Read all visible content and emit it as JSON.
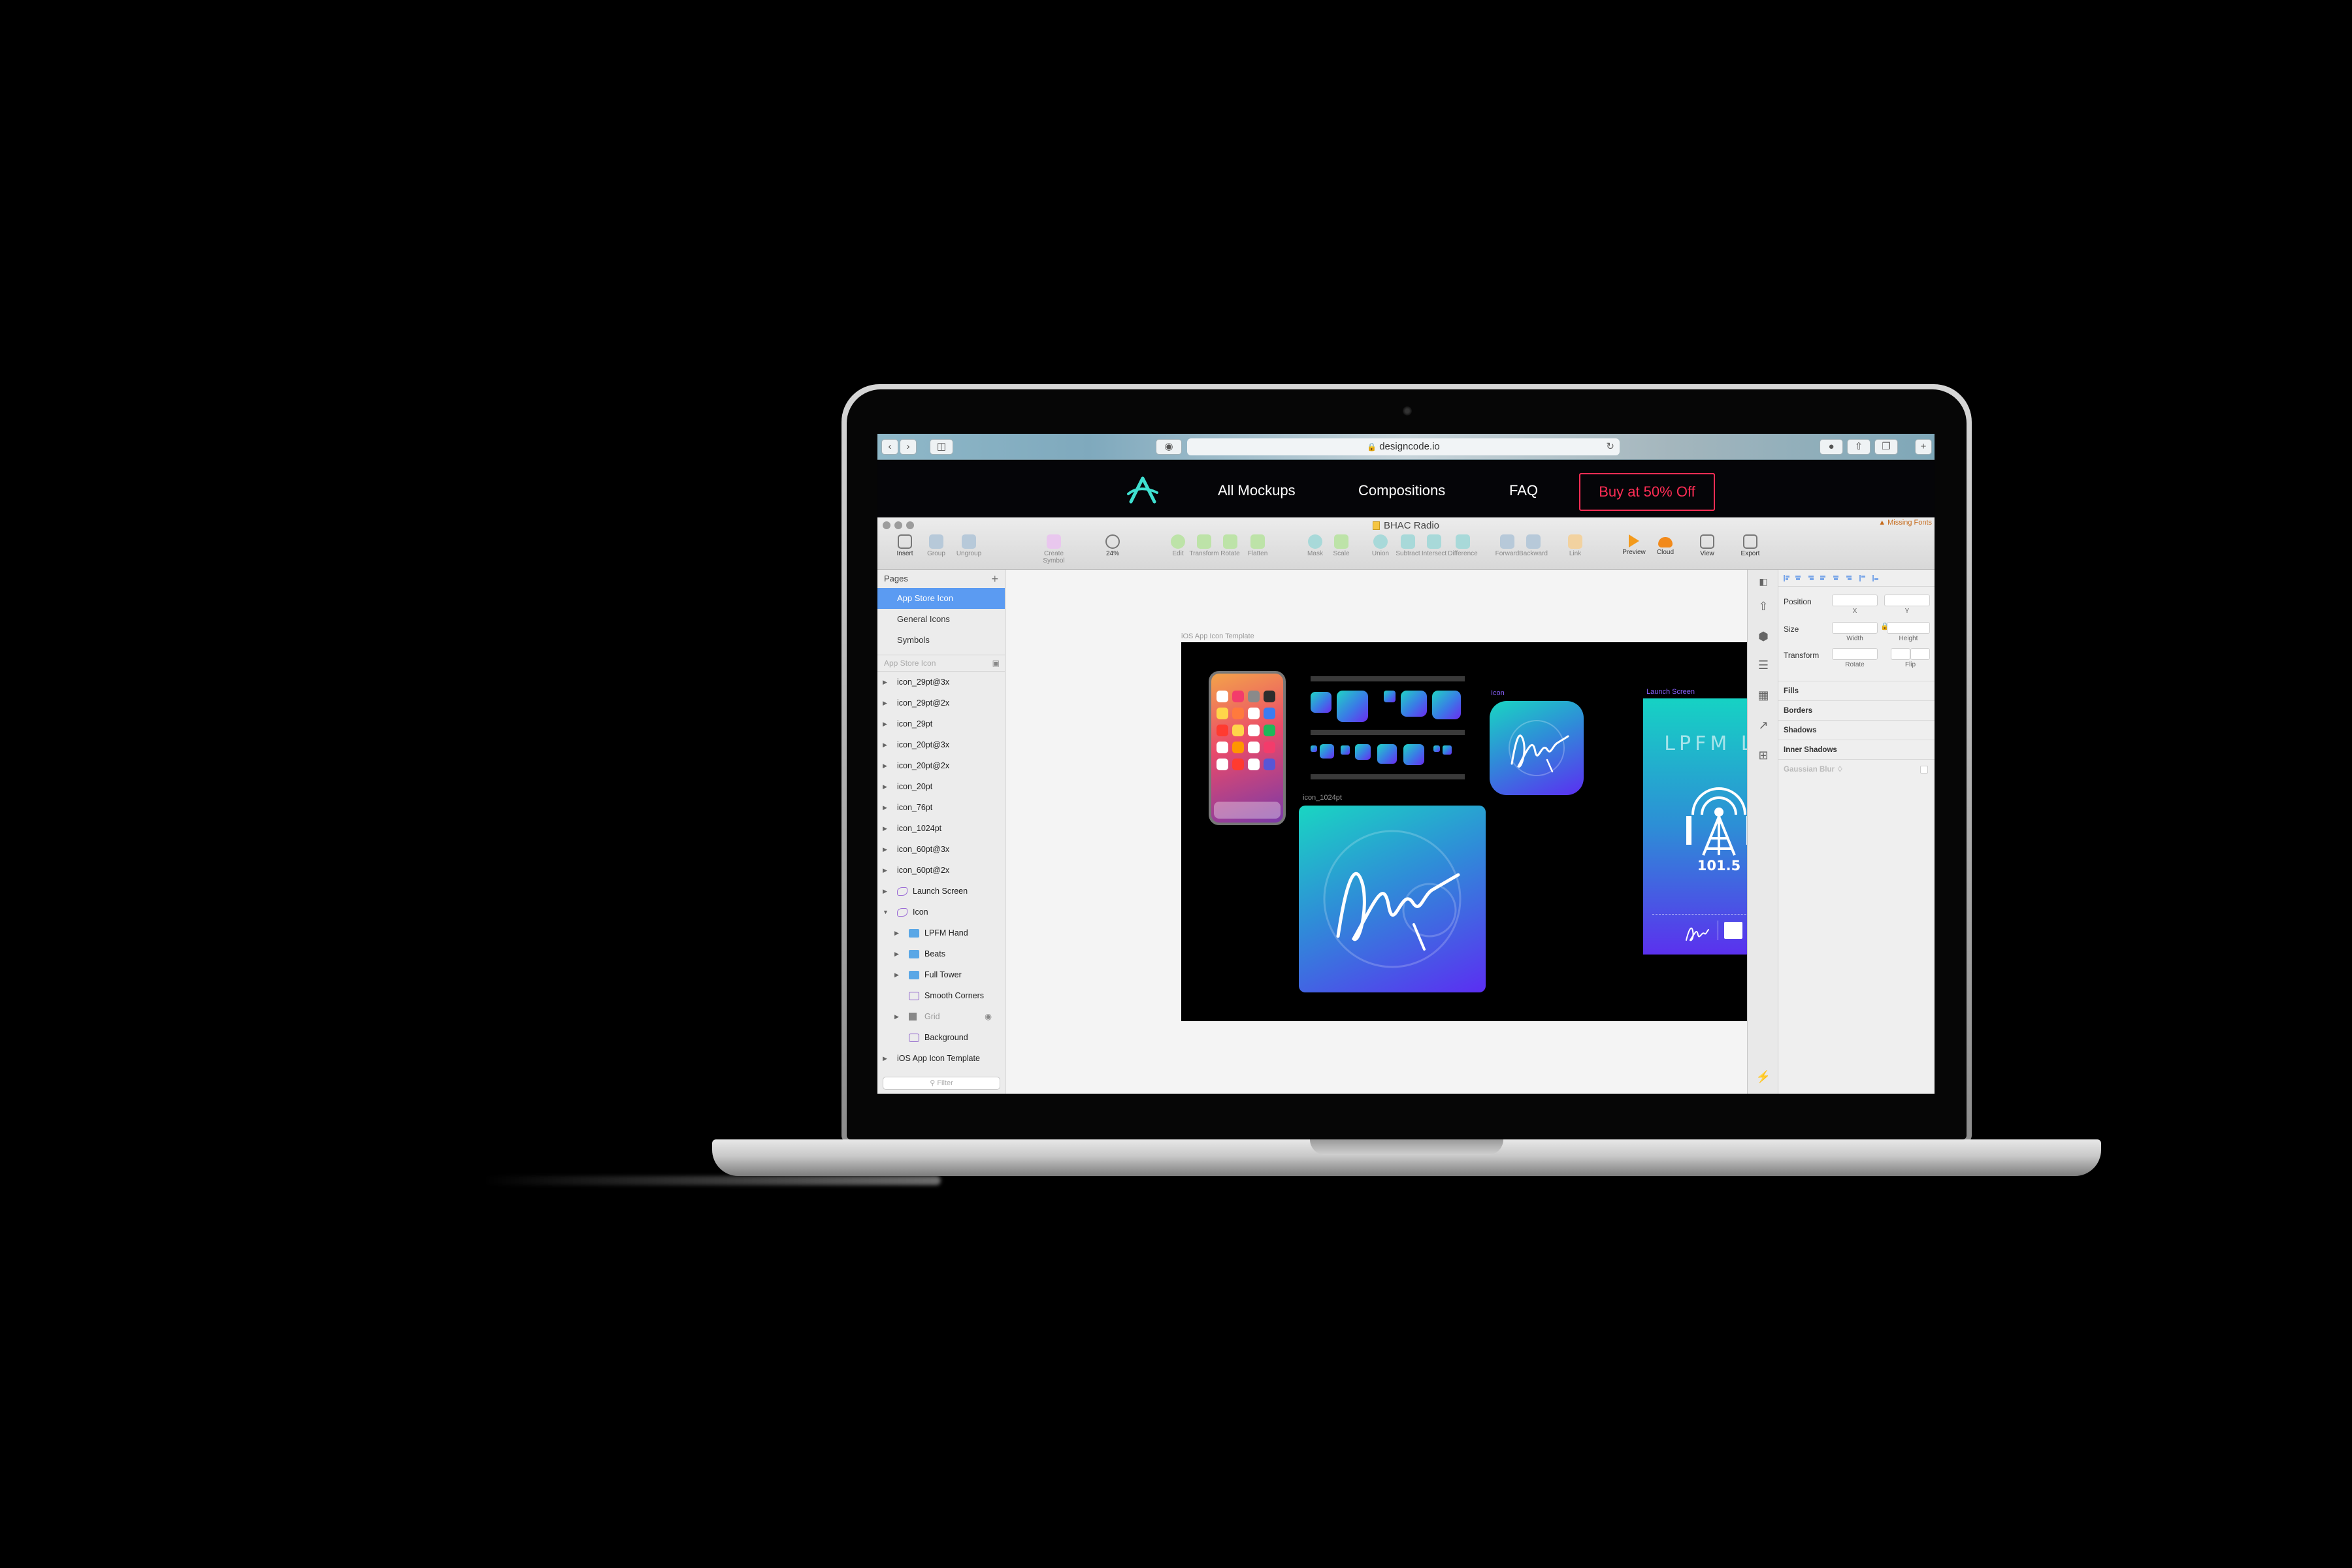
{
  "browser": {
    "url": "designcode.io"
  },
  "site_nav": {
    "links": [
      "All Mockups",
      "Compositions",
      "FAQ"
    ],
    "cta": "Buy at 50% Off",
    "cta_color": "#ff2d55"
  },
  "sketch": {
    "document_title": "BHAC Radio",
    "warning": "▲ Missing Fonts",
    "toolbar": [
      {
        "label": "Insert",
        "icon": "plus-icon",
        "active": true
      },
      {
        "label": "Group",
        "icon": "group-icon",
        "active": false
      },
      {
        "label": "Ungroup",
        "icon": "ungroup-icon",
        "active": false
      },
      {
        "label": "Create Symbol",
        "icon": "symbol-icon",
        "active": false
      },
      {
        "label": "24%",
        "icon": "zoom-icon",
        "active": true
      },
      {
        "label": "Edit",
        "icon": "edit-icon",
        "active": false
      },
      {
        "label": "Transform",
        "icon": "transform-icon",
        "active": false
      },
      {
        "label": "Rotate",
        "icon": "rotate-icon",
        "active": false
      },
      {
        "label": "Flatten",
        "icon": "flatten-icon",
        "active": false
      },
      {
        "label": "Mask",
        "icon": "mask-icon",
        "active": false
      },
      {
        "label": "Scale",
        "icon": "scale-icon",
        "active": false
      },
      {
        "label": "Union",
        "icon": "union-icon",
        "active": false
      },
      {
        "label": "Subtract",
        "icon": "subtract-icon",
        "active": false
      },
      {
        "label": "Intersect",
        "icon": "intersect-icon",
        "active": false
      },
      {
        "label": "Difference",
        "icon": "difference-icon",
        "active": false
      },
      {
        "label": "Forward",
        "icon": "forward-icon",
        "active": false
      },
      {
        "label": "Backward",
        "icon": "backward-icon",
        "active": false
      },
      {
        "label": "Link",
        "icon": "link-icon",
        "active": false
      },
      {
        "label": "Preview",
        "icon": "preview-icon",
        "active": true
      },
      {
        "label": "Cloud",
        "icon": "cloud-icon",
        "active": true
      },
      {
        "label": "View",
        "icon": "view-icon",
        "active": true
      },
      {
        "label": "Export",
        "icon": "export-icon",
        "active": true
      }
    ],
    "pages": {
      "heading": "Pages",
      "items": [
        "App Store Icon",
        "General Icons",
        "Symbols"
      ],
      "selected": "App Store Icon",
      "current_page_label": "App Store Icon"
    },
    "layers": [
      {
        "name": "icon_29pt@3x",
        "type": "artboard"
      },
      {
        "name": "icon_29pt@2x",
        "type": "artboard"
      },
      {
        "name": "icon_29pt",
        "type": "artboard"
      },
      {
        "name": "icon_20pt@3x",
        "type": "artboard"
      },
      {
        "name": "icon_20pt@2x",
        "type": "artboard"
      },
      {
        "name": "icon_20pt",
        "type": "artboard"
      },
      {
        "name": "icon_76pt",
        "type": "artboard"
      },
      {
        "name": "icon_1024pt",
        "type": "artboard"
      },
      {
        "name": "icon_60pt@3x",
        "type": "artboard"
      },
      {
        "name": "icon_60pt@2x",
        "type": "artboard"
      },
      {
        "name": "Launch Screen",
        "type": "symbol"
      },
      {
        "name": "Icon",
        "type": "symbol-open"
      },
      {
        "name": "LPFM Hand",
        "type": "folder"
      },
      {
        "name": "Beats",
        "type": "folder"
      },
      {
        "name": "Full Tower",
        "type": "folder"
      },
      {
        "name": "Smooth Corners",
        "type": "shape"
      },
      {
        "name": "Grid",
        "type": "grid-hidden"
      },
      {
        "name": "Background",
        "type": "shape"
      },
      {
        "name": "iOS App Icon Template",
        "type": "artboard"
      }
    ],
    "filter_placeholder": "Filter",
    "canvas": {
      "artboard_title": "iOS App Icon Template",
      "labels": {
        "icon": "Icon",
        "icon_1024": "icon_1024pt",
        "launch": "Launch Screen"
      },
      "launch_title": "LPFM LA",
      "launch_frequency": "101.5"
    },
    "inspector": {
      "position": "Position",
      "x": "X",
      "y": "Y",
      "size": "Size",
      "width": "Width",
      "height": "Height",
      "transform": "Transform",
      "rotate": "Rotate",
      "flip": "Flip",
      "sections": [
        "Fills",
        "Borders",
        "Shadows",
        "Inner Shadows"
      ],
      "disabled_section": "Gaussian Blur ♢"
    }
  }
}
